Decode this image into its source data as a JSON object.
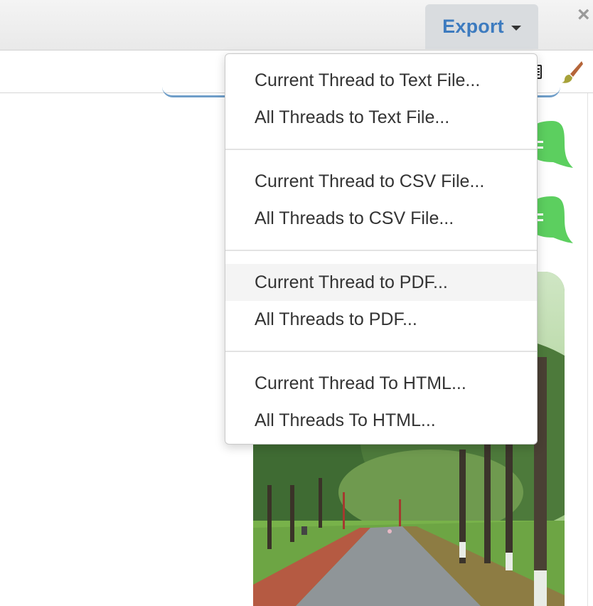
{
  "toolbar": {
    "export_label": "Export",
    "close_glyph": "×"
  },
  "icons": {
    "export_caret": "chevron-down-icon",
    "close": "close-icon",
    "calendar": "calendar-icon",
    "brush": "brush-icon"
  },
  "colors": {
    "accent_blue": "#3d7bbf",
    "bubble_green": "#5ccf5f",
    "menu_highlight": "#f4f4f4"
  },
  "export_menu": {
    "groups": [
      {
        "items": [
          "Current Thread to Text File...",
          "All Threads to Text File..."
        ]
      },
      {
        "items": [
          "Current Thread to CSV File...",
          "All Threads to CSV File..."
        ]
      },
      {
        "items": [
          "Current Thread to PDF...",
          "All Threads to PDF..."
        ]
      },
      {
        "items": [
          "Current Thread To HTML...",
          "All Threads To HTML..."
        ]
      }
    ],
    "highlighted_item": "Current Thread to PDF..."
  }
}
